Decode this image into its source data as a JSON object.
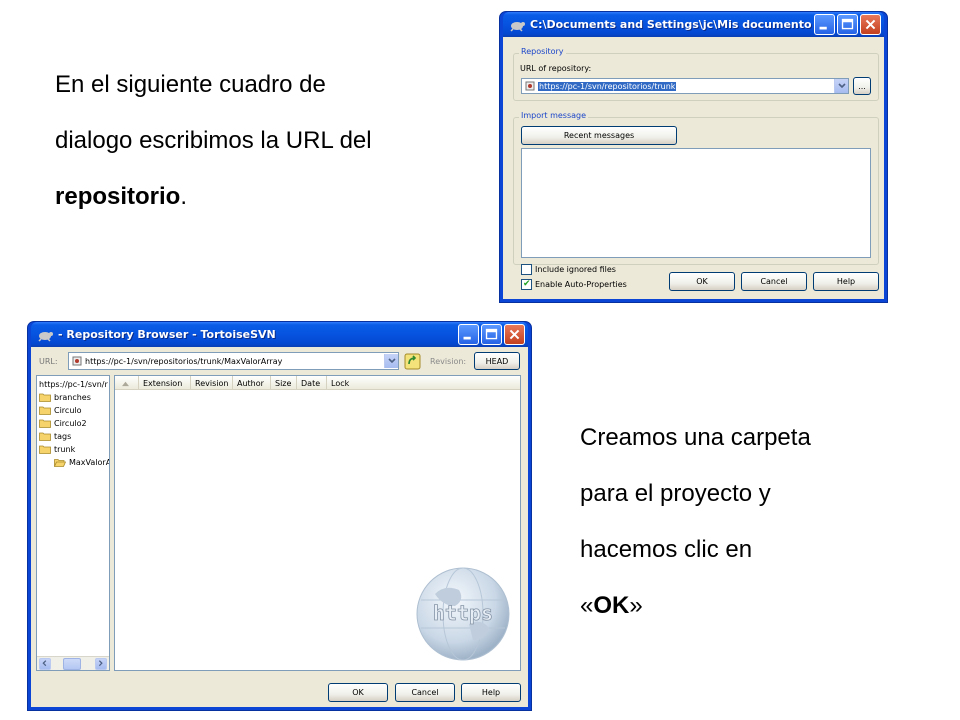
{
  "slide": {
    "caption_top": {
      "line1": "En el siguiente cuadro de",
      "line2": "dialogo escribimos la URL del",
      "line3_bold": "repositorio",
      "line3_tail": "."
    },
    "caption_bottom": {
      "line1": "Creamos una carpeta",
      "line2": "para el proyecto y",
      "line3": "hacemos clic en",
      "line4_open": "«",
      "line4_bold": "OK",
      "line4_close": "»"
    }
  },
  "import_dialog": {
    "title": "C:\\Documents and Settings\\jc\\Mis documentos\\NetBean...",
    "repository_group": "Repository",
    "url_label": "URL of repository:",
    "url_value": "https://pc-1/svn/repositorios/trunk",
    "browse_button": "...",
    "import_group": "Import message",
    "recent_messages_button": "Recent messages",
    "message_text": "",
    "include_ignored_label": "Include ignored files",
    "include_ignored_checked": false,
    "auto_props_label": "Enable Auto-Properties",
    "auto_props_checked": true,
    "ok_button": "OK",
    "cancel_button": "Cancel",
    "help_button": "Help"
  },
  "repo_browser": {
    "title": "- Repository Browser - TortoiseSVN",
    "url_label": "URL:",
    "url_value": "https://pc-1/svn/repositorios/trunk/MaxValorArray",
    "revision_label": "Revision:",
    "revision_button": "HEAD",
    "tree": [
      {
        "label": "https://pc-1/svn/r",
        "level": 0,
        "root": true
      },
      {
        "label": "branches",
        "level": 0
      },
      {
        "label": "Circulo",
        "level": 0
      },
      {
        "label": "Circulo2",
        "level": 0
      },
      {
        "label": "tags",
        "level": 0
      },
      {
        "label": "trunk",
        "level": 0
      },
      {
        "label": "MaxValorA",
        "level": 1,
        "open": true
      }
    ],
    "columns": [
      "Extension",
      "Revision",
      "Author",
      "Size",
      "Date",
      "Lock"
    ],
    "globe_text": "https",
    "ok_button": "OK",
    "cancel_button": "Cancel",
    "help_button": "Help"
  },
  "colors": {
    "xp_blue": "#0a45d6",
    "dialog_face": "#ece9d8",
    "group_label": "#1c46c9",
    "selection": "#316ac5",
    "folder": "#f6d36b"
  }
}
